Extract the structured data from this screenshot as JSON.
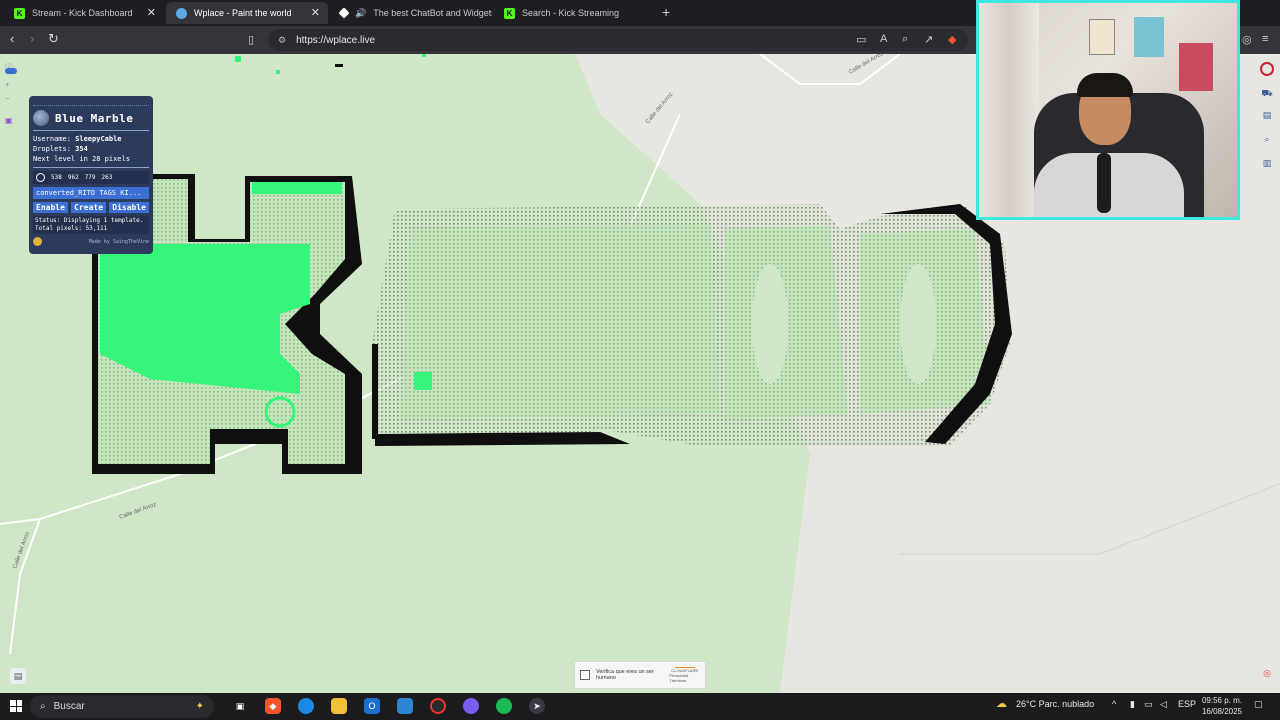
{
  "browser": {
    "tabs": [
      {
        "title": "Stream - Kick Dashboard",
        "favicon": "kick-icon",
        "color": "#53fc18"
      },
      {
        "title": "Wplace - Paint the world",
        "favicon": "wplace-globe-icon",
        "color": "#5aa9e6"
      },
      {
        "title": "The best ChatBot and Widgets fo",
        "favicon": "botrix-icon",
        "color": "#ffffff"
      },
      {
        "title": "Search - Kick Streaming",
        "favicon": "kick-icon",
        "color": "#53fc18"
      }
    ],
    "new_tab_label": "+",
    "url": "https://wplace.live"
  },
  "blue_marble": {
    "title": "Blue Marble",
    "username_label": "Username:",
    "username": "SleepyCable",
    "droplets_label": "Droplets:",
    "droplets": "354",
    "next_level": "Next level in 28 pixels",
    "coords": [
      "538",
      "962",
      "779",
      "263"
    ],
    "template_name": "converted_RITO TAGS KI...",
    "buttons": {
      "enable": "Enable",
      "create": "Create",
      "disable": "Disable"
    },
    "status": "Status: Displaying 1 template.",
    "status_more": "Total pixels: 53,111",
    "credit": "Made by SwingTheVine"
  },
  "map": {
    "street_labels": [
      "Calle del Arroz",
      "Calle del Arroz",
      "Calle del Arroz",
      "Calle del Arroz"
    ],
    "colors": {
      "green": "#35f57a",
      "light_green": "#cfe6c7",
      "light_gray": "#e8e6e1",
      "black": "#0f0f0f"
    }
  },
  "captcha": {
    "text": "Verifica que eres un ser humano",
    "brand": "CLOUDFLARE",
    "links": "Privacidad · Términos"
  },
  "taskbar": {
    "search_placeholder": "Buscar",
    "weather": "26°C  Parc. nublado",
    "language": "ESP",
    "time": "09:56 p. m.",
    "date": "16/08/2025"
  }
}
